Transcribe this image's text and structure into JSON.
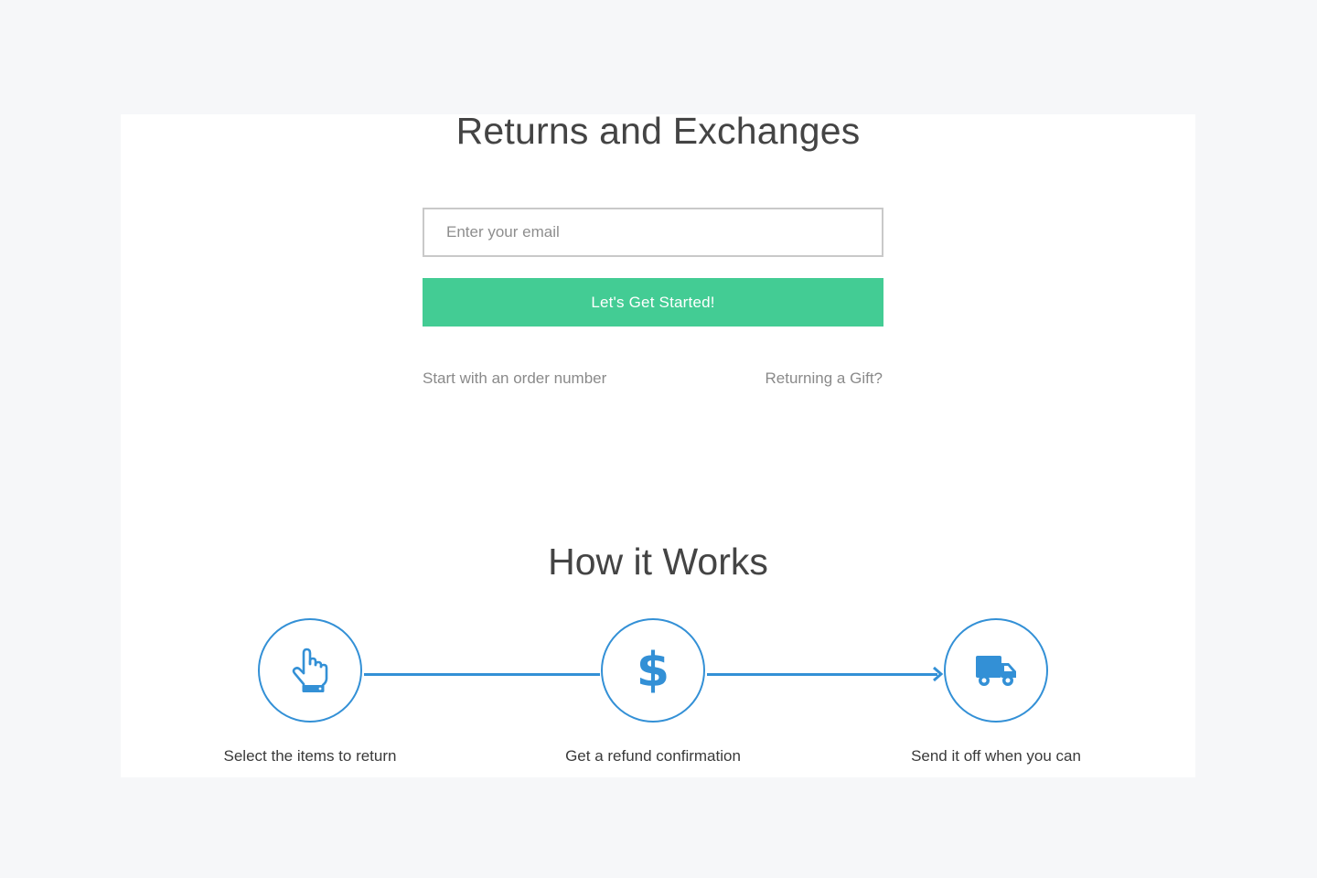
{
  "returns": {
    "title": "Returns and Exchanges",
    "email_placeholder": "Enter your email",
    "start_button_label": "Let's Get Started!",
    "order_number_link": "Start with an order number",
    "gift_link": "Returning a Gift?"
  },
  "how_it_works": {
    "title": "How it Works",
    "steps": [
      {
        "label": "Select the items to return",
        "icon": "pointing-hand-icon"
      },
      {
        "label": "Get a refund confirmation",
        "icon": "dollar-icon",
        "glyph": "$"
      },
      {
        "label": "Send it off when you can",
        "icon": "truck-icon"
      }
    ]
  },
  "colors": {
    "page_background": "#f6f7f9",
    "card_background": "#ffffff",
    "accent_green": "#43cc94",
    "accent_blue": "#3390d6",
    "heading_text": "#444444",
    "muted_text": "#8a8a8a"
  }
}
